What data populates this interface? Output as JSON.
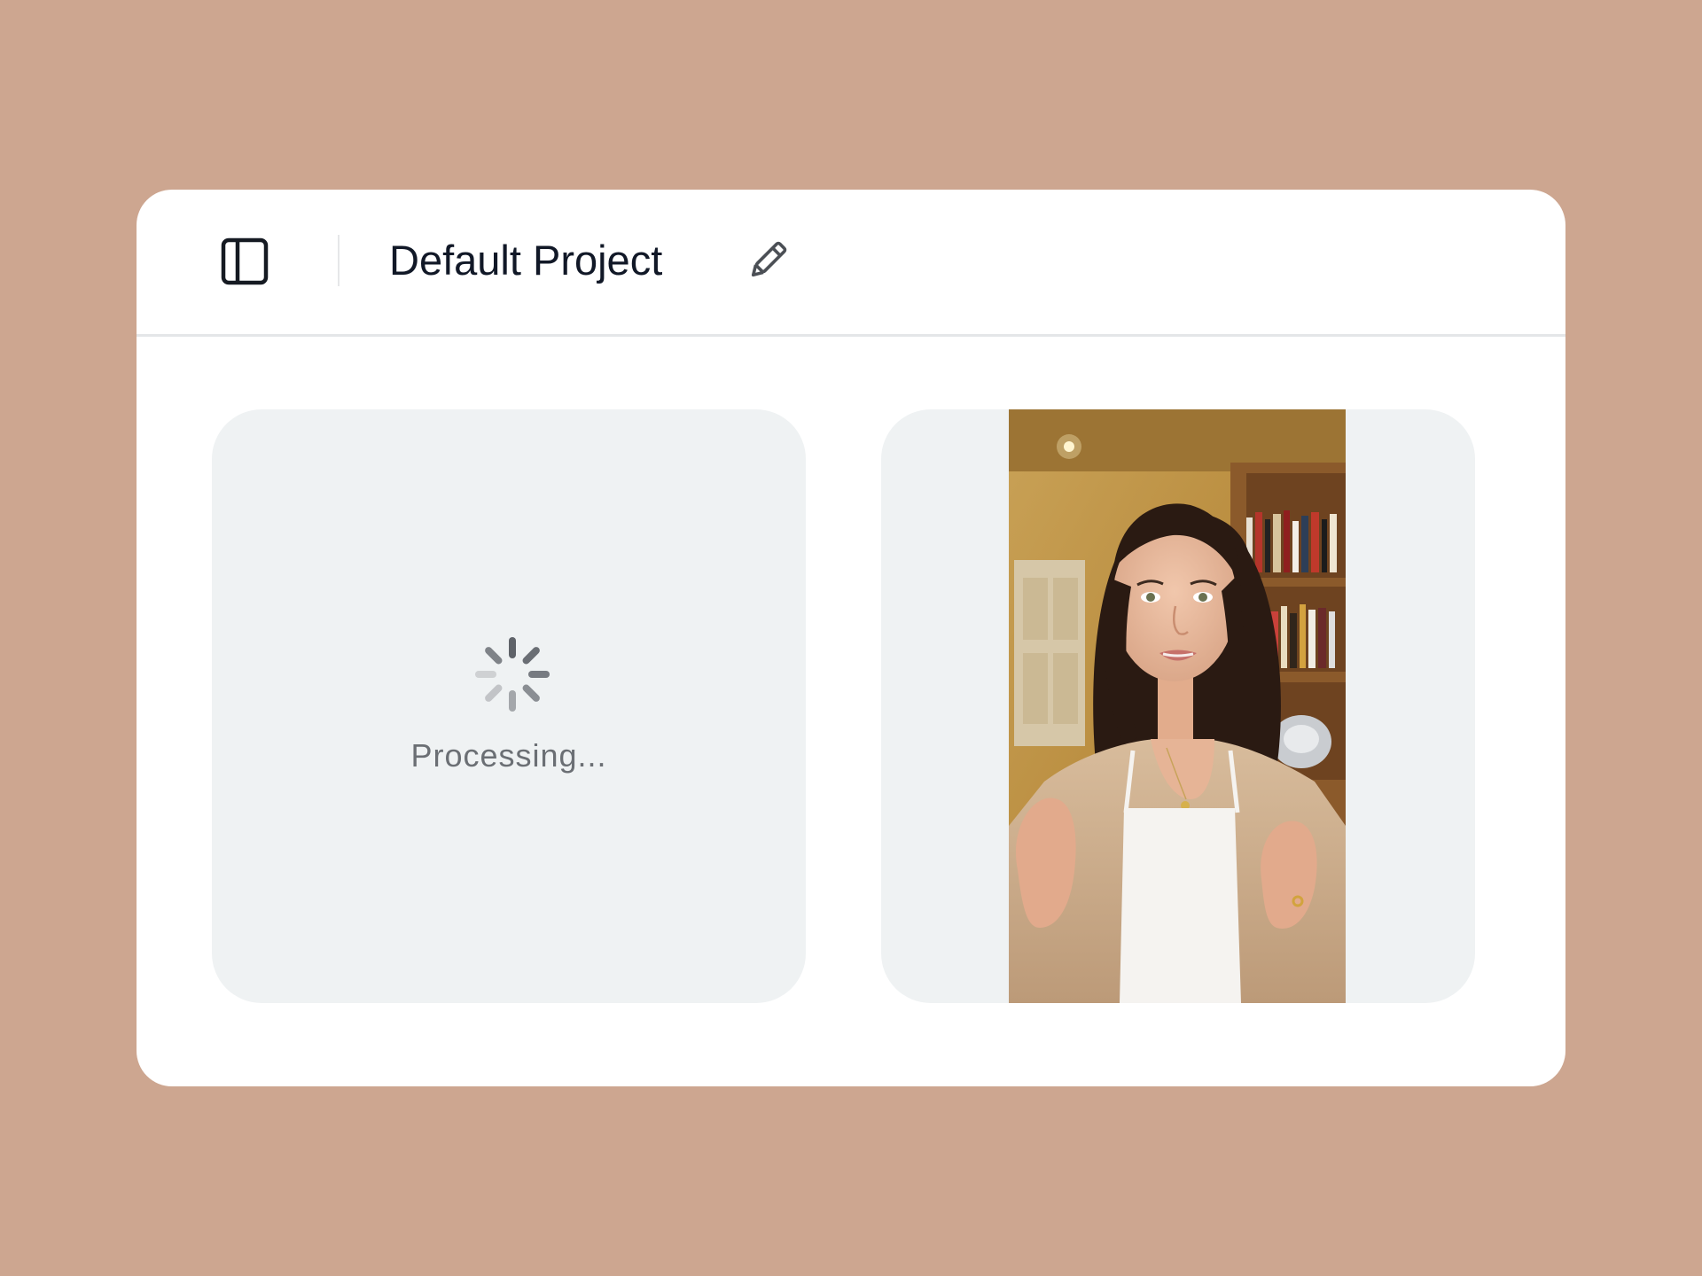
{
  "header": {
    "title": "Default Project",
    "sidebar_toggle_icon": "sidebar-panel-icon",
    "edit_icon": "pencil-icon"
  },
  "cards": [
    {
      "status_text": "Processing...",
      "status_icon": "loading-spinner-icon"
    },
    {
      "media": "video-thumbnail"
    }
  ],
  "colors": {
    "background": "#cda690",
    "window": "#ffffff",
    "card": "#eff2f3",
    "title_text": "#111827",
    "status_text": "#6b6f74"
  }
}
